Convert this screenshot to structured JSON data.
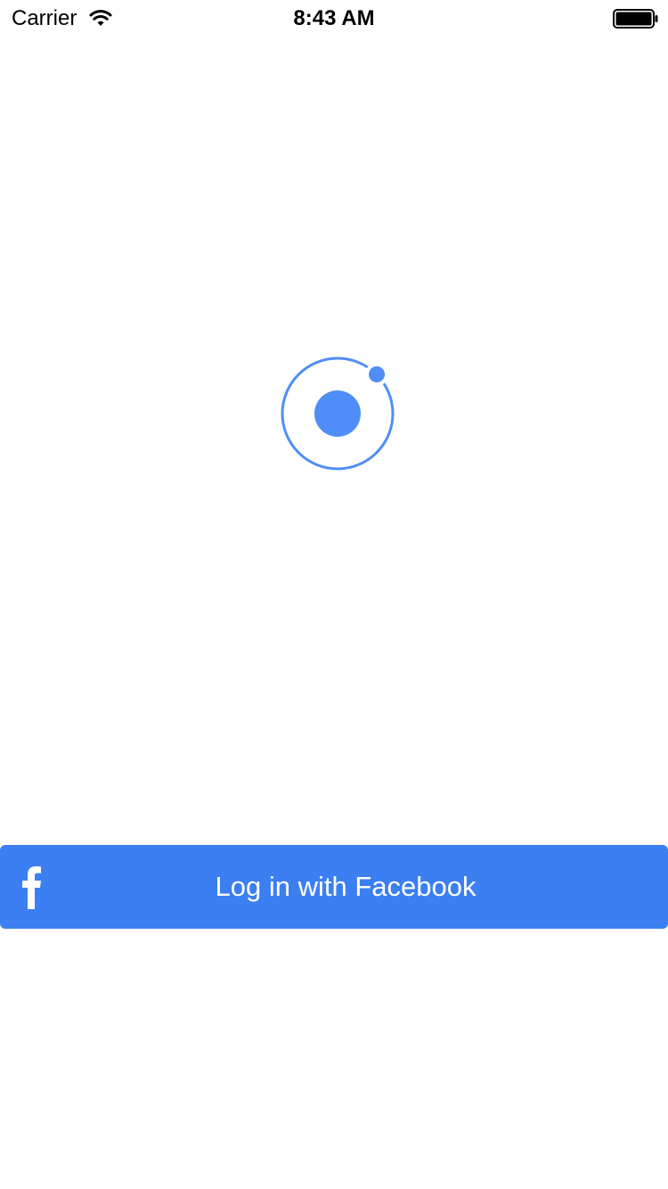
{
  "status_bar": {
    "carrier": "Carrier",
    "time": "8:43 AM",
    "battery_level": 1.0
  },
  "logo": {
    "icon": "ionic-logo-icon",
    "color": "#4f8ef7"
  },
  "login": {
    "button_label": "Log in with Facebook",
    "icon": "facebook-icon",
    "color": "#3b7ff2"
  }
}
